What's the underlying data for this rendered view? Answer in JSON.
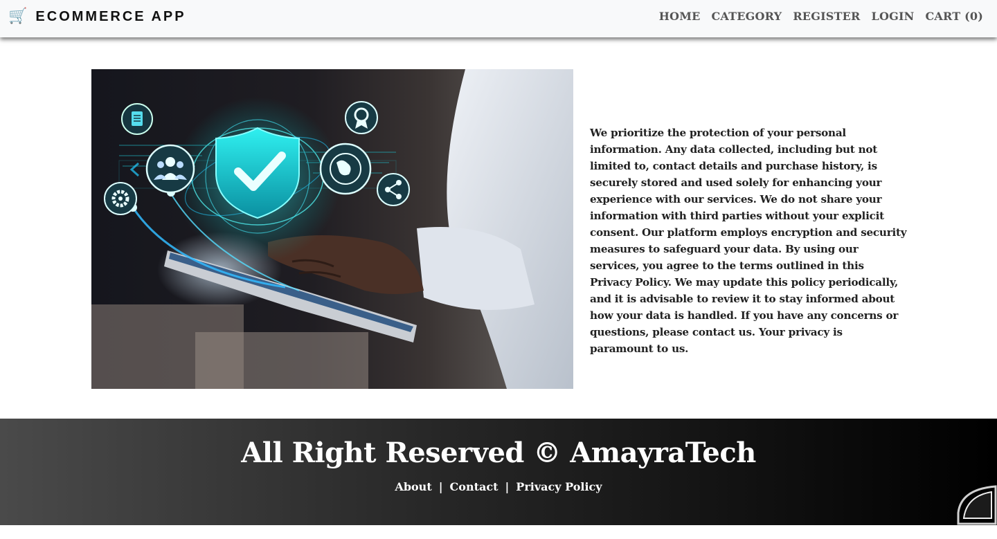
{
  "navbar": {
    "brand_icon": "🛒",
    "brand": "ECOMMERCE APP",
    "links": [
      "HOME",
      "CATEGORY",
      "REGISTER",
      "LOGIN",
      "CART (0)"
    ]
  },
  "main": {
    "image_icons": [
      "document-icon",
      "users-icon",
      "shield-check-icon",
      "award-icon",
      "globe-icon",
      "share-icon",
      "gear-icon"
    ],
    "policy_text": "We prioritize the protection of your personal information. Any data collected, including but not limited to, contact details and purchase history, is securely stored and used solely for enhancing your experience with our services. We do not share your information with third parties without your explicit consent. Our platform employs encryption and security measures to safeguard your data. By using our services, you agree to the terms outlined in this Privacy Policy. We may update this policy periodically, and it is advisable to review it to stay informed about how your data is handled. If you have any concerns or questions, please contact us. Your privacy is paramount to us."
  },
  "footer": {
    "title": "All Right Reserved © AmayraTech",
    "links": [
      "About",
      "Contact",
      "Privacy Policy"
    ],
    "separator": "|"
  },
  "colors": {
    "accent_cyan": "#19d6e0",
    "footer_start": "#4a4a4a",
    "footer_end": "#000000"
  }
}
